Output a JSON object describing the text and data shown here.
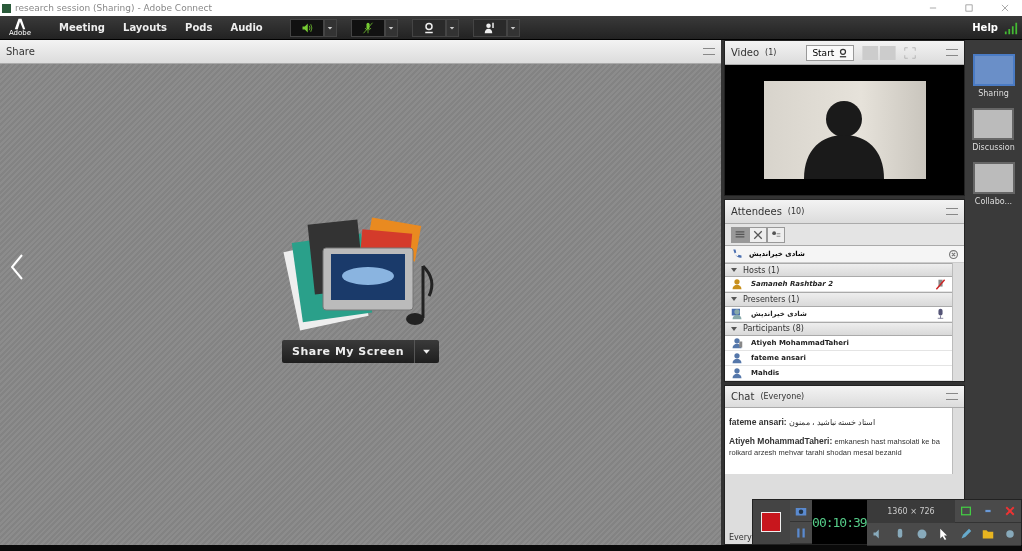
{
  "window": {
    "title": "research session (Sharing) - Adobe Connect"
  },
  "menu": {
    "logo": "Adobe",
    "items": [
      "Meeting",
      "Layouts",
      "Pods",
      "Audio"
    ],
    "help": "Help"
  },
  "share": {
    "title": "Share",
    "button": "Share My Screen"
  },
  "video": {
    "title": "Video",
    "count": "(1)",
    "start": "Start"
  },
  "attendees": {
    "title": "Attendees",
    "count": "(10)",
    "views": [
      {
        "selected": true
      },
      {
        "selected": false
      },
      {
        "selected": false
      }
    ],
    "speaker": "شادی خیراندیش",
    "groups": [
      {
        "label": "Hosts (1)",
        "expanded": true,
        "members": [
          {
            "name": "Samaneh Rashtbar 2",
            "kind": "host"
          }
        ]
      },
      {
        "label": "Presenters (1)",
        "expanded": true,
        "members": [
          {
            "name": "شادی خیراندیش",
            "kind": "presenter"
          }
        ]
      },
      {
        "label": "Participants (8)",
        "expanded": true,
        "members": [
          {
            "name": "Atiyeh MohammadTaheri",
            "kind": "phone"
          },
          {
            "name": "fateme ansari",
            "kind": "participant"
          },
          {
            "name": "Mahdis",
            "kind": "participant"
          }
        ]
      }
    ]
  },
  "chat": {
    "title": "Chat",
    "scope": "(Everyone)",
    "messages": [
      {
        "sender": "fateme ansari:",
        "text": "استاد خسته نباشید ، ممنون"
      },
      {
        "sender": "Atiyeh MohammadTaheri:",
        "text": "emkanesh hast mahsolati ke ba roikard arzesh mehvar tarahi shodan mesal bezanid"
      }
    ],
    "footer": "Every"
  },
  "recorder": {
    "time": "00:10:39",
    "resolution": "1360 × 726"
  },
  "layouts": [
    {
      "label": "Sharing",
      "selected": true
    },
    {
      "label": "Discussion",
      "selected": false
    },
    {
      "label": "Collabo...",
      "selected": false
    }
  ]
}
